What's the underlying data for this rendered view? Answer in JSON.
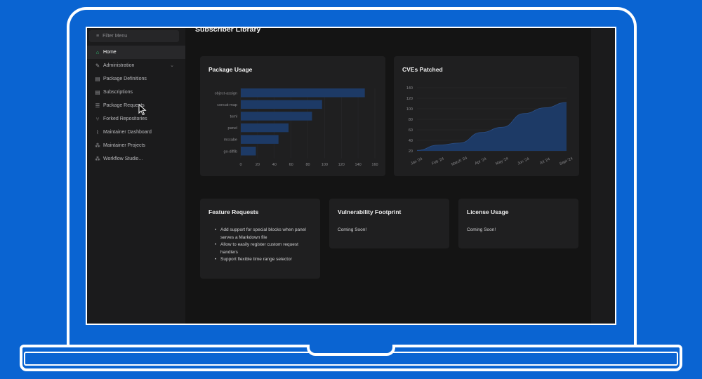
{
  "sidebar": {
    "filter_placeholder": "Filter Menu",
    "items": [
      {
        "label": "Home",
        "icon": "home-icon",
        "glyph": "⌂",
        "active": true
      },
      {
        "label": "Administration",
        "icon": "wrench-icon",
        "glyph": "✎",
        "expandable": true
      },
      {
        "label": "Package Definitions",
        "icon": "file-icon",
        "glyph": "▤"
      },
      {
        "label": "Subscriptions",
        "icon": "file-icon",
        "glyph": "▤"
      },
      {
        "label": "Package Requests",
        "icon": "list-icon",
        "glyph": "☰"
      },
      {
        "label": "Forked Repositories",
        "icon": "fork-icon",
        "glyph": "⑂"
      },
      {
        "label": "Maintainer Dashboard",
        "icon": "chart-icon",
        "glyph": "⌇"
      },
      {
        "label": "Maintainer Projects",
        "icon": "projects-icon",
        "glyph": "⁂"
      },
      {
        "label": "Workflow Studio...",
        "icon": "workflow-icon",
        "glyph": "⁂"
      }
    ]
  },
  "main": {
    "title": "Subscriber Library",
    "cards": {
      "package_usage": {
        "title": "Package Usage"
      },
      "cves_patched": {
        "title": "CVEs Patched"
      },
      "feature_requests": {
        "title": "Feature Requests",
        "items": [
          "Add support for special blocks when panel serves a Markdown file",
          "Allow to easily register custom request handlers",
          "Support flexible time range selector"
        ]
      },
      "vulnerability_footprint": {
        "title": "Vulnerability Footprint",
        "body": "Coming Soon!"
      },
      "license_usage": {
        "title": "License Usage",
        "body": "Coming Soon!"
      }
    }
  },
  "colors": {
    "accent_green": "#2fbf71",
    "bar_color": "#1d3a66",
    "area_color": "#1d3a66"
  },
  "chart_data": [
    {
      "type": "bar",
      "orientation": "horizontal",
      "title": "Package Usage",
      "categories": [
        "object-assign",
        "concat-map",
        "toml",
        "panel",
        "mccabe",
        "go-diffib"
      ],
      "values": [
        148,
        97,
        85,
        57,
        45,
        18
      ],
      "xlim": [
        0,
        160
      ],
      "xticks": [
        0,
        20,
        40,
        60,
        80,
        100,
        120,
        140,
        160
      ]
    },
    {
      "type": "area",
      "title": "CVEs Patched",
      "x": [
        "Jan '24",
        "Feb '24",
        "March '24",
        "Apr '24",
        "May '24",
        "Jun '24",
        "Jul '24",
        "Sept '24"
      ],
      "values": [
        21,
        31,
        35,
        55,
        65,
        91,
        102,
        112
      ],
      "ylim": [
        20,
        140
      ],
      "yticks": [
        20,
        40,
        60,
        80,
        100,
        120,
        140
      ]
    }
  ]
}
